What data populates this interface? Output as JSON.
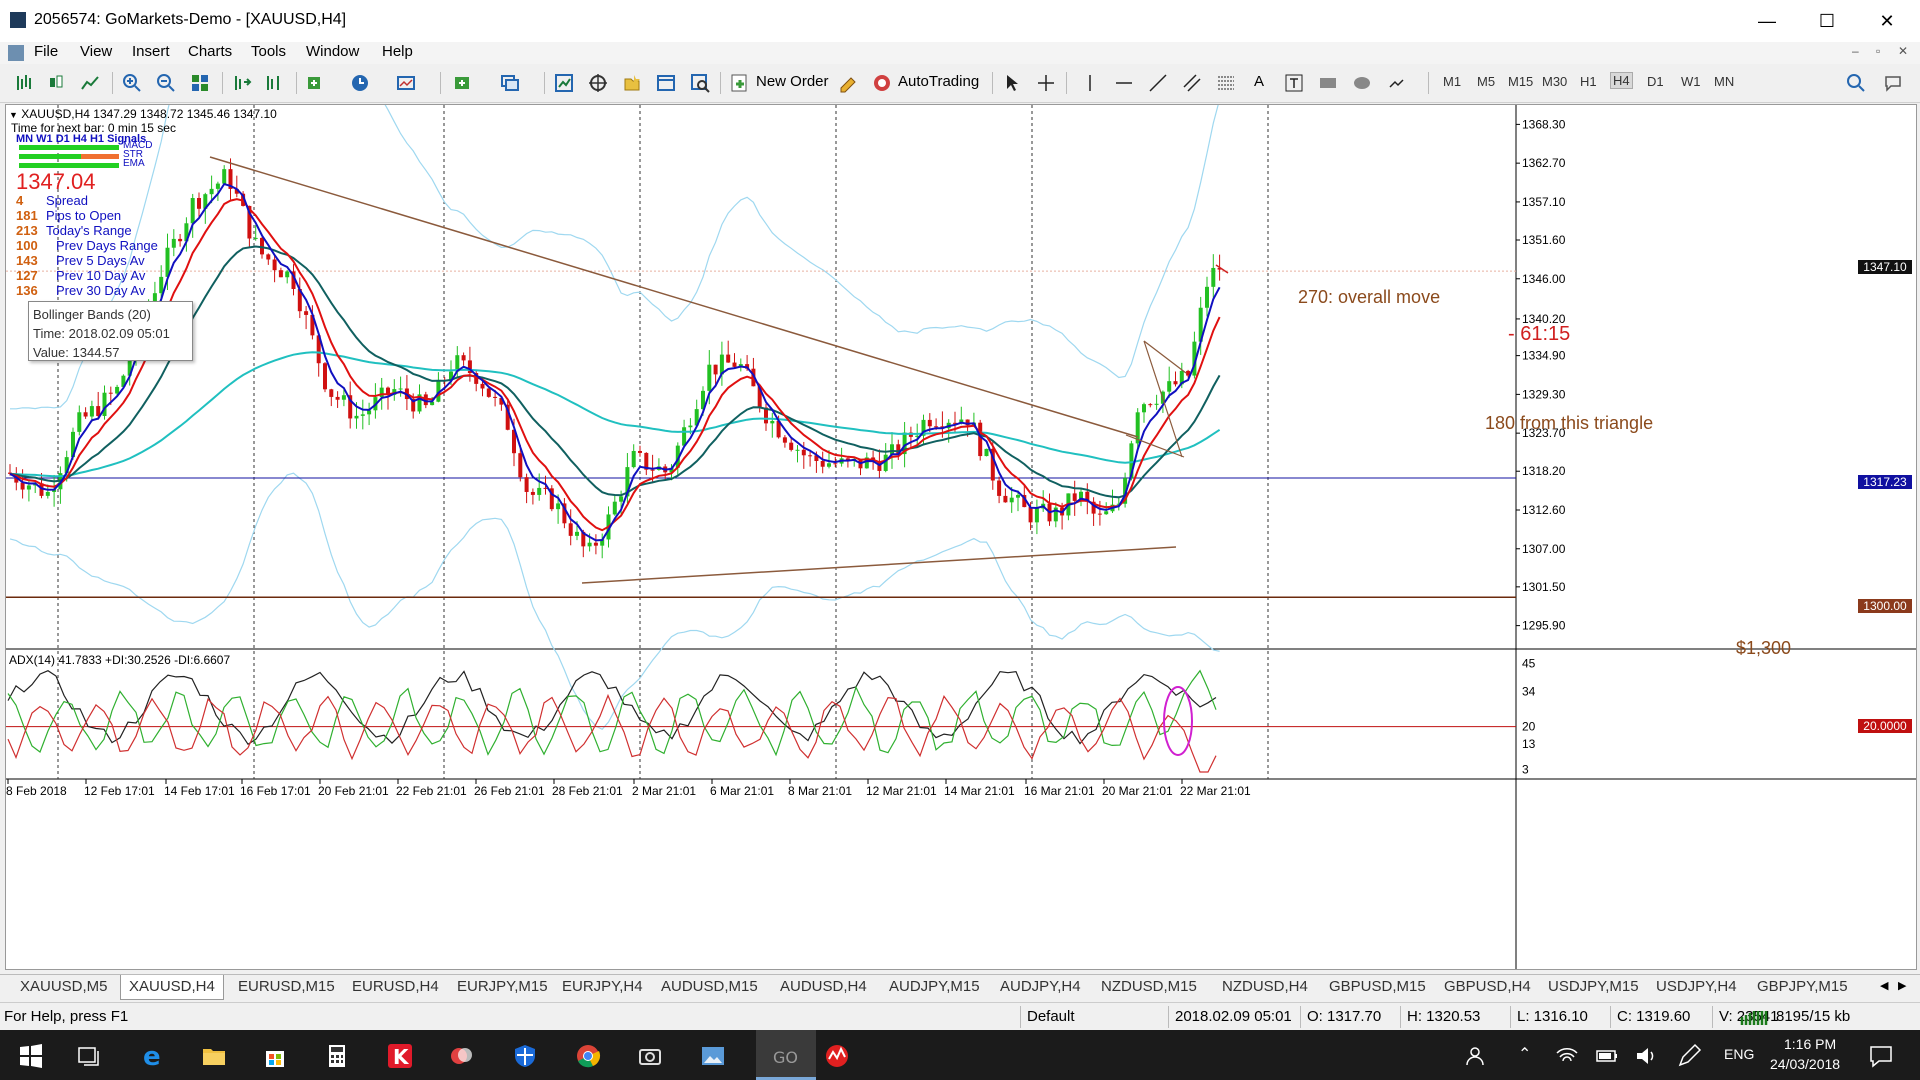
{
  "window": {
    "title": "2056574: GoMarkets-Demo - [XAUUSD,H4]",
    "minimize": "—",
    "maximize": "☐",
    "close": "✕"
  },
  "menu": [
    "File",
    "View",
    "Insert",
    "Charts",
    "Tools",
    "Window",
    "Help"
  ],
  "toolbar": {
    "new_order": "New Order",
    "autotrading": "AutoTrading",
    "timeframes": [
      "M1",
      "M5",
      "M15",
      "M30",
      "H1",
      "H4",
      "D1",
      "W1",
      "MN"
    ],
    "active_timeframe": "H4"
  },
  "chart": {
    "header": "XAUUSD,H4  1347.29 1348.72 1345.46 1347.10",
    "timer": "Time for next bar: 0 min 15 sec",
    "signals_header": "MN W1 D1  H4  H1  Signals",
    "signal_labels": [
      "MACD",
      "STR",
      "EMA"
    ],
    "big_price": "1347.04",
    "stats": [
      {
        "value": "4",
        "label": "Spread"
      },
      {
        "value": "181",
        "label": "Pips to Open"
      },
      {
        "value": "213",
        "label": "Today's Range"
      },
      {
        "value": "100",
        "label": "Prev Days Range"
      },
      {
        "value": "143",
        "label": "Prev 5 Days Av"
      },
      {
        "value": "127",
        "label": "Prev 10 Day Av"
      },
      {
        "value": "136",
        "label": "Prev 30 Day Av"
      }
    ],
    "tooltip": {
      "name": "Bollinger Bands (20)",
      "time": "Time: 2018.02.09 05:01",
      "value": "Value: 1344.57"
    },
    "annotations": {
      "overall_move": "270: overall move",
      "pullback": "- 61:15",
      "triangle": "180 from this triangle",
      "level": "$1,300"
    },
    "price_axis": [
      "1368.30",
      "1362.70",
      "1357.10",
      "1351.60",
      "1346.00",
      "1340.20",
      "1334.90",
      "1329.30",
      "1323.70",
      "1318.20",
      "1312.60",
      "1307.00",
      "1301.50",
      "1295.90"
    ],
    "price_badges": {
      "current": "1347.10",
      "line_blue": "1317.23",
      "line_brown": "1300.00"
    },
    "adx_header": "ADX(14) 41.7833 +DI:30.2526 -DI:6.6607",
    "adx_axis": [
      "45",
      "34",
      "20",
      "13",
      "3"
    ],
    "adx_badge": "20.0000",
    "time_axis": [
      "8 Feb 2018",
      "12 Feb 17:01",
      "14 Feb 17:01",
      "16 Feb 17:01",
      "20 Feb 21:01",
      "22 Feb 21:01",
      "26 Feb 21:01",
      "28 Feb 21:01",
      "2 Mar 21:01",
      "6 Mar 21:01",
      "8 Mar 21:01",
      "12 Mar 21:01",
      "14 Mar 21:01",
      "16 Mar 21:01",
      "20 Mar 21:01",
      "22 Mar 21:01"
    ],
    "colors": {
      "bull": "#22c022",
      "bear": "#d01010",
      "ema_fast": "#1010c0",
      "ema_mid": "#e01010",
      "ema_slow": "#106060",
      "ma_long": "#20c0c0",
      "bands": "#9fd8f0",
      "trend": "#8b5a3c"
    }
  },
  "tabs": [
    "XAUUSD,M5",
    "XAUUSD,H4",
    "EURUSD,M15",
    "EURUSD,H4",
    "EURJPY,M15",
    "EURJPY,H4",
    "AUDUSD,M15",
    "AUDUSD,H4",
    "AUDJPY,M15",
    "AUDJPY,H4",
    "NZDUSD,M15",
    "NZDUSD,H4",
    "GBPUSD,M15",
    "GBPUSD,H4",
    "USDJPY,M15",
    "USDJPY,H4",
    "GBPJPY,M15"
  ],
  "active_tab": "XAUUSD,H4",
  "status": {
    "help": "For Help, press F1",
    "profile": "Default",
    "datetime": "2018.02.09 05:01",
    "open": "O: 1317.70",
    "high": "H: 1320.53",
    "low": "L: 1316.10",
    "close": "C: 1319.60",
    "volume": "V: 23541",
    "traffic": "8195/15 kb"
  },
  "taskbar": {
    "lang": "ENG",
    "time": "1:16 PM",
    "date": "24/03/2018"
  }
}
